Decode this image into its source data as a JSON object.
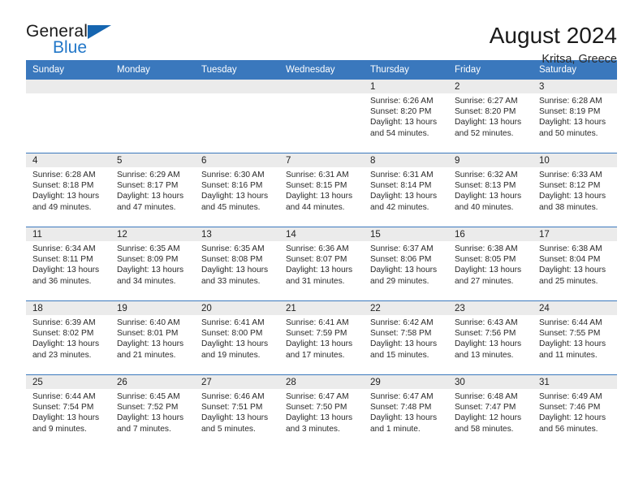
{
  "brand": {
    "word1": "General",
    "word2": "Blue",
    "triangle_icon": "blue-triangle-logo-mark",
    "color_primary": "#1565b0",
    "color_text": "#2277c8"
  },
  "header": {
    "title": "August 2024",
    "location": "Kritsa, Greece"
  },
  "theme": {
    "header_row_bg": "#3a78bd",
    "daynum_band_bg": "#ebebeb",
    "row_divider": "#3a78bd",
    "text": "#2a2a2a"
  },
  "calendar": {
    "weekday_headers": [
      "Sunday",
      "Monday",
      "Tuesday",
      "Wednesday",
      "Thursday",
      "Friday",
      "Saturday"
    ],
    "labels": {
      "sunrise": "Sunrise:",
      "sunset": "Sunset:",
      "daylight": "Daylight:"
    },
    "weeks": [
      [
        {
          "day": "",
          "sunrise": "",
          "sunset": "",
          "daylight_line1": "",
          "daylight_line2": "",
          "empty": true
        },
        {
          "day": "",
          "sunrise": "",
          "sunset": "",
          "daylight_line1": "",
          "daylight_line2": "",
          "empty": true
        },
        {
          "day": "",
          "sunrise": "",
          "sunset": "",
          "daylight_line1": "",
          "daylight_line2": "",
          "empty": true
        },
        {
          "day": "",
          "sunrise": "",
          "sunset": "",
          "daylight_line1": "",
          "daylight_line2": "",
          "empty": true
        },
        {
          "day": "1",
          "sunrise": "Sunrise: 6:26 AM",
          "sunset": "Sunset: 8:20 PM",
          "daylight_line1": "Daylight: 13 hours",
          "daylight_line2": "and 54 minutes."
        },
        {
          "day": "2",
          "sunrise": "Sunrise: 6:27 AM",
          "sunset": "Sunset: 8:20 PM",
          "daylight_line1": "Daylight: 13 hours",
          "daylight_line2": "and 52 minutes."
        },
        {
          "day": "3",
          "sunrise": "Sunrise: 6:28 AM",
          "sunset": "Sunset: 8:19 PM",
          "daylight_line1": "Daylight: 13 hours",
          "daylight_line2": "and 50 minutes."
        }
      ],
      [
        {
          "day": "4",
          "sunrise": "Sunrise: 6:28 AM",
          "sunset": "Sunset: 8:18 PM",
          "daylight_line1": "Daylight: 13 hours",
          "daylight_line2": "and 49 minutes."
        },
        {
          "day": "5",
          "sunrise": "Sunrise: 6:29 AM",
          "sunset": "Sunset: 8:17 PM",
          "daylight_line1": "Daylight: 13 hours",
          "daylight_line2": "and 47 minutes."
        },
        {
          "day": "6",
          "sunrise": "Sunrise: 6:30 AM",
          "sunset": "Sunset: 8:16 PM",
          "daylight_line1": "Daylight: 13 hours",
          "daylight_line2": "and 45 minutes."
        },
        {
          "day": "7",
          "sunrise": "Sunrise: 6:31 AM",
          "sunset": "Sunset: 8:15 PM",
          "daylight_line1": "Daylight: 13 hours",
          "daylight_line2": "and 44 minutes."
        },
        {
          "day": "8",
          "sunrise": "Sunrise: 6:31 AM",
          "sunset": "Sunset: 8:14 PM",
          "daylight_line1": "Daylight: 13 hours",
          "daylight_line2": "and 42 minutes."
        },
        {
          "day": "9",
          "sunrise": "Sunrise: 6:32 AM",
          "sunset": "Sunset: 8:13 PM",
          "daylight_line1": "Daylight: 13 hours",
          "daylight_line2": "and 40 minutes."
        },
        {
          "day": "10",
          "sunrise": "Sunrise: 6:33 AM",
          "sunset": "Sunset: 8:12 PM",
          "daylight_line1": "Daylight: 13 hours",
          "daylight_line2": "and 38 minutes."
        }
      ],
      [
        {
          "day": "11",
          "sunrise": "Sunrise: 6:34 AM",
          "sunset": "Sunset: 8:11 PM",
          "daylight_line1": "Daylight: 13 hours",
          "daylight_line2": "and 36 minutes."
        },
        {
          "day": "12",
          "sunrise": "Sunrise: 6:35 AM",
          "sunset": "Sunset: 8:09 PM",
          "daylight_line1": "Daylight: 13 hours",
          "daylight_line2": "and 34 minutes."
        },
        {
          "day": "13",
          "sunrise": "Sunrise: 6:35 AM",
          "sunset": "Sunset: 8:08 PM",
          "daylight_line1": "Daylight: 13 hours",
          "daylight_line2": "and 33 minutes."
        },
        {
          "day": "14",
          "sunrise": "Sunrise: 6:36 AM",
          "sunset": "Sunset: 8:07 PM",
          "daylight_line1": "Daylight: 13 hours",
          "daylight_line2": "and 31 minutes."
        },
        {
          "day": "15",
          "sunrise": "Sunrise: 6:37 AM",
          "sunset": "Sunset: 8:06 PM",
          "daylight_line1": "Daylight: 13 hours",
          "daylight_line2": "and 29 minutes."
        },
        {
          "day": "16",
          "sunrise": "Sunrise: 6:38 AM",
          "sunset": "Sunset: 8:05 PM",
          "daylight_line1": "Daylight: 13 hours",
          "daylight_line2": "and 27 minutes."
        },
        {
          "day": "17",
          "sunrise": "Sunrise: 6:38 AM",
          "sunset": "Sunset: 8:04 PM",
          "daylight_line1": "Daylight: 13 hours",
          "daylight_line2": "and 25 minutes."
        }
      ],
      [
        {
          "day": "18",
          "sunrise": "Sunrise: 6:39 AM",
          "sunset": "Sunset: 8:02 PM",
          "daylight_line1": "Daylight: 13 hours",
          "daylight_line2": "and 23 minutes."
        },
        {
          "day": "19",
          "sunrise": "Sunrise: 6:40 AM",
          "sunset": "Sunset: 8:01 PM",
          "daylight_line1": "Daylight: 13 hours",
          "daylight_line2": "and 21 minutes."
        },
        {
          "day": "20",
          "sunrise": "Sunrise: 6:41 AM",
          "sunset": "Sunset: 8:00 PM",
          "daylight_line1": "Daylight: 13 hours",
          "daylight_line2": "and 19 minutes."
        },
        {
          "day": "21",
          "sunrise": "Sunrise: 6:41 AM",
          "sunset": "Sunset: 7:59 PM",
          "daylight_line1": "Daylight: 13 hours",
          "daylight_line2": "and 17 minutes."
        },
        {
          "day": "22",
          "sunrise": "Sunrise: 6:42 AM",
          "sunset": "Sunset: 7:58 PM",
          "daylight_line1": "Daylight: 13 hours",
          "daylight_line2": "and 15 minutes."
        },
        {
          "day": "23",
          "sunrise": "Sunrise: 6:43 AM",
          "sunset": "Sunset: 7:56 PM",
          "daylight_line1": "Daylight: 13 hours",
          "daylight_line2": "and 13 minutes."
        },
        {
          "day": "24",
          "sunrise": "Sunrise: 6:44 AM",
          "sunset": "Sunset: 7:55 PM",
          "daylight_line1": "Daylight: 13 hours",
          "daylight_line2": "and 11 minutes."
        }
      ],
      [
        {
          "day": "25",
          "sunrise": "Sunrise: 6:44 AM",
          "sunset": "Sunset: 7:54 PM",
          "daylight_line1": "Daylight: 13 hours",
          "daylight_line2": "and 9 minutes."
        },
        {
          "day": "26",
          "sunrise": "Sunrise: 6:45 AM",
          "sunset": "Sunset: 7:52 PM",
          "daylight_line1": "Daylight: 13 hours",
          "daylight_line2": "and 7 minutes."
        },
        {
          "day": "27",
          "sunrise": "Sunrise: 6:46 AM",
          "sunset": "Sunset: 7:51 PM",
          "daylight_line1": "Daylight: 13 hours",
          "daylight_line2": "and 5 minutes."
        },
        {
          "day": "28",
          "sunrise": "Sunrise: 6:47 AM",
          "sunset": "Sunset: 7:50 PM",
          "daylight_line1": "Daylight: 13 hours",
          "daylight_line2": "and 3 minutes."
        },
        {
          "day": "29",
          "sunrise": "Sunrise: 6:47 AM",
          "sunset": "Sunset: 7:48 PM",
          "daylight_line1": "Daylight: 13 hours",
          "daylight_line2": "and 1 minute."
        },
        {
          "day": "30",
          "sunrise": "Sunrise: 6:48 AM",
          "sunset": "Sunset: 7:47 PM",
          "daylight_line1": "Daylight: 12 hours",
          "daylight_line2": "and 58 minutes."
        },
        {
          "day": "31",
          "sunrise": "Sunrise: 6:49 AM",
          "sunset": "Sunset: 7:46 PM",
          "daylight_line1": "Daylight: 12 hours",
          "daylight_line2": "and 56 minutes."
        }
      ]
    ]
  }
}
